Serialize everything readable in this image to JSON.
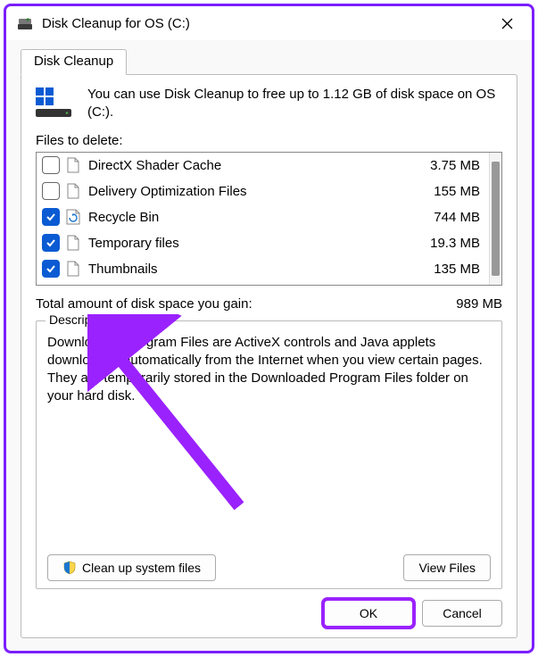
{
  "window": {
    "title": "Disk Cleanup for OS (C:)"
  },
  "tab": {
    "label": "Disk Cleanup"
  },
  "info": {
    "text": "You can use Disk Cleanup to free up to 1.12 GB of disk space on OS (C:)."
  },
  "files_label": "Files to delete:",
  "rows": [
    {
      "name": "DirectX Shader Cache",
      "size": "3.75 MB",
      "checked": false,
      "icon": "file"
    },
    {
      "name": "Delivery Optimization Files",
      "size": "155 MB",
      "checked": false,
      "icon": "file"
    },
    {
      "name": "Recycle Bin",
      "size": "744 MB",
      "checked": true,
      "icon": "recycle"
    },
    {
      "name": "Temporary files",
      "size": "19.3 MB",
      "checked": true,
      "icon": "file"
    },
    {
      "name": "Thumbnails",
      "size": "135 MB",
      "checked": true,
      "icon": "file"
    }
  ],
  "total": {
    "label": "Total amount of disk space you gain:",
    "value": "989 MB"
  },
  "description": {
    "legend": "Description",
    "text": "Downloaded Program Files are ActiveX controls and Java applets downloaded automatically from the Internet when you view certain pages. They are temporarily stored in the Downloaded Program Files folder on your hard disk."
  },
  "buttons": {
    "cleanup": "Clean up system files",
    "view": "View Files",
    "ok": "OK",
    "cancel": "Cancel"
  }
}
